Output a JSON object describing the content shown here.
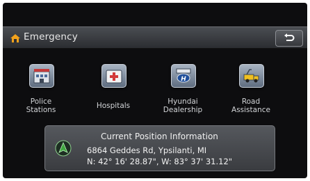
{
  "header": {
    "title": "Emergency",
    "home_icon": "home-icon",
    "back_icon": "back-arrow-icon"
  },
  "menu": {
    "items": [
      {
        "label_line1": "Police",
        "label_line2": "Stations",
        "icon": "police-station-icon"
      },
      {
        "label_line1": "Hospitals",
        "label_line2": "",
        "icon": "hospital-icon"
      },
      {
        "label_line1": "Hyundai",
        "label_line2": "Dealership",
        "icon": "hyundai-dealership-icon"
      },
      {
        "label_line1": "Road",
        "label_line2": "Assistance",
        "icon": "road-assistance-icon"
      }
    ]
  },
  "position": {
    "title": "Current Position Information",
    "address": "6864 Geddes Rd, Ypsilanti, MI",
    "coordinates": "N: 42° 16' 28.87\", W: 83° 37' 31.12\"",
    "icon": "navigation-arrow-icon"
  },
  "colors": {
    "background": "#0d0d0f",
    "bar": "#3a3c40",
    "accent_green": "#3fa63f"
  }
}
